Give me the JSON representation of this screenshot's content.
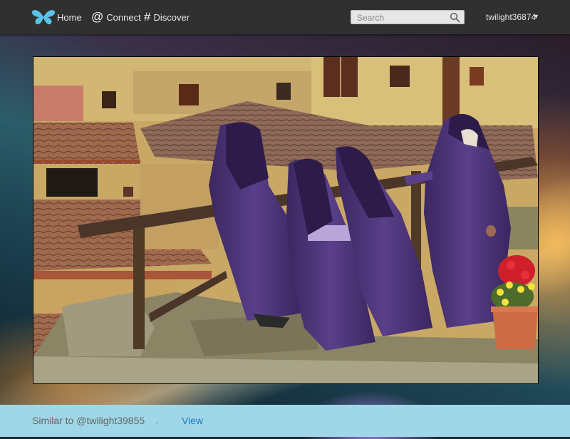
{
  "nav": {
    "home_label": "Home",
    "connect_glyph": "@",
    "connect_label": "Connect",
    "discover_glyph": "#",
    "discover_label": "Discover"
  },
  "search": {
    "placeholder": "Search",
    "value": ""
  },
  "user": {
    "name": "twilight36874",
    "caret": "▼"
  },
  "footer": {
    "similar_text": "Similar to @twilight39855",
    "separator": ".",
    "view_label": "View"
  },
  "icons": {
    "logo": "butterfly-logo-icon",
    "search": "search-icon",
    "caret": "caret-down-icon"
  },
  "colors": {
    "topbar": "#303030",
    "bottombar": "#9fd7e8",
    "link": "#1a7cc4",
    "logo": "#5bc3e8"
  }
}
